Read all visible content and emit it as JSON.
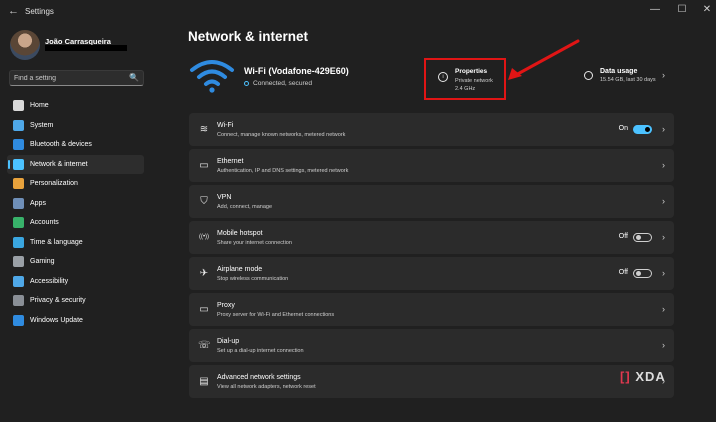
{
  "window": {
    "title": "Settings",
    "back_glyph": "←",
    "min_glyph": "—",
    "max_glyph": "☐",
    "close_glyph": "✕"
  },
  "user": {
    "name": "João Carrasqueira"
  },
  "search": {
    "placeholder": "Find a setting",
    "icon": "🔍"
  },
  "nav": [
    {
      "label": "Home",
      "icon": "home-icon",
      "color": "#d9d9d9"
    },
    {
      "label": "System",
      "icon": "system-icon",
      "color": "#4fa8e8"
    },
    {
      "label": "Bluetooth & devices",
      "icon": "bluetooth-icon",
      "color": "#2f8be0"
    },
    {
      "label": "Network & internet",
      "icon": "network-icon",
      "color": "#4cc2ff",
      "active": true
    },
    {
      "label": "Personalization",
      "icon": "brush-icon",
      "color": "#e8a23c"
    },
    {
      "label": "Apps",
      "icon": "apps-icon",
      "color": "#6f8fb8"
    },
    {
      "label": "Accounts",
      "icon": "accounts-icon",
      "color": "#38b26a"
    },
    {
      "label": "Time & language",
      "icon": "globe-icon",
      "color": "#3aa6e0"
    },
    {
      "label": "Gaming",
      "icon": "gaming-icon",
      "color": "#9aa0a6"
    },
    {
      "label": "Accessibility",
      "icon": "accessibility-icon",
      "color": "#4fa8e8"
    },
    {
      "label": "Privacy & security",
      "icon": "shield-icon",
      "color": "#8a8f96"
    },
    {
      "label": "Windows Update",
      "icon": "update-icon",
      "color": "#2f8be0"
    }
  ],
  "main": {
    "title": "Network & internet",
    "hero": {
      "network": "Wi-Fi (Vodafone-429E60)",
      "status": "Connected, secured"
    },
    "properties": {
      "icon": "i",
      "title": "Properties",
      "line1": "Private network",
      "line2": "2.4 GHz"
    },
    "data_usage": {
      "title": "Data usage",
      "subtitle": "15.54 GB, last 30 days",
      "chevron": "›"
    },
    "rows": [
      {
        "title": "Wi-Fi",
        "subtitle": "Connect, manage known networks, metered network",
        "icon": "wifi-icon",
        "glyph": "≋",
        "toggle": "On",
        "chevron": "›"
      },
      {
        "title": "Ethernet",
        "subtitle": "Authentication, IP and DNS settings, metered network",
        "icon": "ethernet-icon",
        "glyph": "▭",
        "chevron": "›"
      },
      {
        "title": "VPN",
        "subtitle": "Add, connect, manage",
        "icon": "vpn-shield-icon",
        "glyph": "⛉",
        "chevron": "›"
      },
      {
        "title": "Mobile hotspot",
        "subtitle": "Share your internet connection",
        "icon": "hotspot-icon",
        "glyph": "((•))",
        "toggle": "Off",
        "chevron": "›"
      },
      {
        "title": "Airplane mode",
        "subtitle": "Stop wireless communication",
        "icon": "airplane-icon",
        "glyph": "✈",
        "toggle": "Off",
        "chevron": "›"
      },
      {
        "title": "Proxy",
        "subtitle": "Proxy server for Wi-Fi and Ethernet connections",
        "icon": "proxy-icon",
        "glyph": "▭",
        "chevron": "›"
      },
      {
        "title": "Dial-up",
        "subtitle": "Set up a dial-up internet connection",
        "icon": "dialup-icon",
        "glyph": "☏",
        "chevron": "›"
      },
      {
        "title": "Advanced network settings",
        "subtitle": "View all network adapters, network reset",
        "icon": "advanced-network-icon",
        "glyph": "▤",
        "chevron": "›"
      }
    ]
  },
  "watermark": {
    "bracket_left": "[",
    "bracket_right": "]",
    "text": "XDA"
  }
}
